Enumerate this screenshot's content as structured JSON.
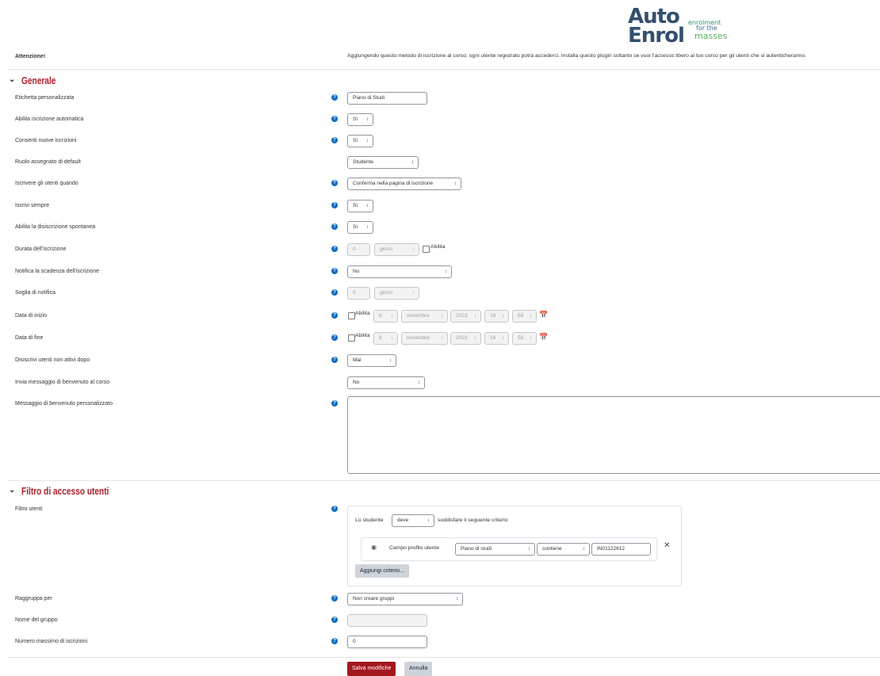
{
  "logo": {
    "line1": "Auto",
    "line2": "Enrol",
    "tagline1": "enrolment",
    "tagline2": "for the",
    "tagline3": "masses"
  },
  "warning": {
    "label": "Attenzione!",
    "text": "Aggiungendo questo metodo di iscrizione al corso, ogni utente registrato potrà accederci. Installa questo plugin soltanto se vuoi l'accesso libero al tuo corso per gli utenti che si autenticheranno."
  },
  "general": {
    "title": "Generale",
    "custom_label": {
      "label": "Etichetta personalizzata",
      "value": "Piano di Studi"
    },
    "auto_enrol": {
      "label": "Abilita iscrizione automatica",
      "value": "Sì"
    },
    "allow_new": {
      "label": "Consenti nuove iscrizioni",
      "value": "Sì"
    },
    "default_role": {
      "label": "Ruolo assegnato di default",
      "value": "Studente"
    },
    "enrol_when": {
      "label": "Iscrivere gli utenti quando",
      "value": "Conferma nella pagina di iscrizione"
    },
    "always_enrol": {
      "label": "Iscrivi sempre",
      "value": "Sì"
    },
    "self_unenrol": {
      "label": "Abilita la disiscrizione spontanea",
      "value": "Sì"
    },
    "duration": {
      "label": "Durata dell'iscrizione",
      "number": "0",
      "unit": "giorni",
      "enable": "Abilita"
    },
    "notify_expiry": {
      "label": "Notifica la scadenza dell'iscrizione",
      "value": "No"
    },
    "notify_threshold": {
      "label": "Soglia di notifica",
      "number": "0",
      "unit": "giorni"
    },
    "start_date": {
      "label": "Data di inizio",
      "enable": "Abilita",
      "day": "8",
      "month": "novembre",
      "year": "2023",
      "hour": "16",
      "minute": "58"
    },
    "end_date": {
      "label": "Data di fine",
      "enable": "Abilita",
      "day": "8",
      "month": "novembre",
      "year": "2023",
      "hour": "16",
      "minute": "58"
    },
    "unenrol_inactive": {
      "label": "Disiscrivi utenti non attivi dopo",
      "value": "Mai"
    },
    "send_welcome": {
      "label": "Invia messaggio di benvenuto al corso",
      "value": "No"
    },
    "welcome_message": {
      "label": "Messaggio di benvenuto personalizzato",
      "value": ""
    }
  },
  "filter": {
    "title": "Filtro di accesso utenti",
    "users_filter_label": "Filtro utenti",
    "sentence_start": "Lo studente",
    "must_value": "deve",
    "sentence_end": "soddisfare il seguente criterio",
    "criterion": {
      "field_label": "Campo profilo utente",
      "field_value": "Piano di studi",
      "operator": "contiene",
      "value": "IN01122612"
    },
    "add_criterion": "Aggiungi criterio...",
    "group_by": {
      "label": "Raggruppa per",
      "value": "Non creare gruppi"
    },
    "group_name": {
      "label": "Nome del gruppo",
      "value": ""
    },
    "max_enrolled": {
      "label": "Numero massimo di iscrizioni",
      "value": "0"
    }
  },
  "buttons": {
    "save": "Salva modifiche",
    "cancel": "Annulla"
  },
  "icons": {
    "help": "help-icon",
    "collapse": "chevron-down-icon",
    "visibility": "eye-icon",
    "remove": "close-icon",
    "calendar": "calendar-icon"
  },
  "colors": {
    "accent": "#a3171f",
    "section_title": "#b1202c",
    "help": "#0f6cbf"
  }
}
